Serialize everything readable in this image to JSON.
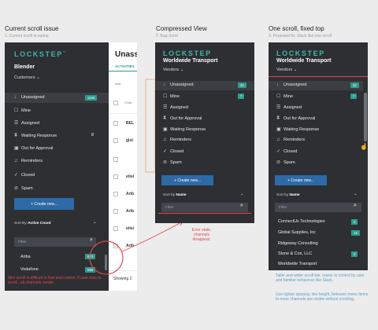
{
  "sections": [
    {
      "title": "Current scroll issue",
      "subtitle": "1. Current scroll in laptop"
    },
    {
      "title": "Compressed View",
      "subtitle": "2. Bug: Error"
    },
    {
      "title": "One scroll, fixed top",
      "subtitle": "3. Proposed fix: Slack like one scroll"
    }
  ],
  "panel1": {
    "logo": "LOCKSTEP",
    "logo_tm": "™",
    "org": "Blender",
    "dropdown": "Customers",
    "menu": [
      {
        "icon": "unassigned-icon",
        "glyph": "↓",
        "label": "Unassigned",
        "count": "1146"
      },
      {
        "icon": "mine-icon",
        "glyph": "☐",
        "label": "Mine",
        "count": ""
      },
      {
        "icon": "assigned-icon",
        "glyph": "☰",
        "label": "Assigned",
        "count": ""
      },
      {
        "icon": "waiting-response-icon",
        "glyph": "⧗",
        "label": "Waiting Response",
        "count": "8"
      },
      {
        "icon": "out-for-approval-icon",
        "glyph": "▣",
        "label": "Out for Approval",
        "count": ""
      },
      {
        "icon": "reminders-icon",
        "glyph": "♫",
        "label": "Reminders",
        "count": ""
      },
      {
        "icon": "closed-icon",
        "glyph": "✓",
        "label": "Closed",
        "count": ""
      },
      {
        "icon": "spam-icon",
        "glyph": "⊘",
        "label": "Spam",
        "count": ""
      }
    ],
    "create_label": "+ Create new...",
    "sort_prefix": "Sort By ",
    "sort_value": "Active Count",
    "filter_placeholder": "Filter",
    "vendors": [
      {
        "name": "Ariba",
        "count": "573"
      },
      {
        "name": "Vodafone",
        "count": "555"
      }
    ],
    "note": "Mini scroll is difficult to find and control. If user tries to scroll , all channels vanish."
  },
  "content": {
    "title": "Unass",
    "tab": "ACTIVITIES",
    "col_label": "Assi",
    "col2": "CHAI",
    "rows": [
      "BEL",
      "glol",
      "",
      "etisi",
      "Arib",
      "Arib",
      "etisi",
      "Arib"
    ],
    "footer": "Showing 2"
  },
  "panel2": {
    "logo": "LOCKSTEP",
    "org": "Worldwide Transport",
    "dropdown": "Vendors",
    "menu": [
      {
        "icon": "unassigned-icon",
        "glyph": "↓",
        "label": "Unassigned",
        "count": "32"
      },
      {
        "icon": "mine-icon",
        "glyph": "☐",
        "label": "Mine",
        "count": "7"
      },
      {
        "icon": "assigned-icon",
        "glyph": "☰",
        "label": "Assigned",
        "count": ""
      },
      {
        "icon": "out-for-approval-icon",
        "glyph": "⧗",
        "label": "Out for Approval",
        "count": ""
      },
      {
        "icon": "waiting-response-icon",
        "glyph": "▣",
        "label": "Waiting Response",
        "count": ""
      },
      {
        "icon": "reminders-icon",
        "glyph": "♫",
        "label": "Reminders",
        "count": ""
      },
      {
        "icon": "closed-icon",
        "glyph": "✓",
        "label": "Closed",
        "count": ""
      },
      {
        "icon": "spam-icon",
        "glyph": "⊘",
        "label": "Spam",
        "count": ""
      }
    ],
    "create_label": "+ Create new...",
    "sort_prefix": "Sort by ",
    "sort_value": "Name",
    "filter_placeholder": "Filter",
    "error_note": "Error state, channels disappear."
  },
  "panel3": {
    "logo": "LOCKSTEP",
    "org": "Worldwide Transport",
    "dropdown": "Vendors",
    "menu": [
      {
        "icon": "unassigned-icon",
        "glyph": "↓",
        "label": "Unassigned",
        "count": "32"
      },
      {
        "icon": "mine-icon",
        "glyph": "☐",
        "label": "Mine",
        "count": "7"
      },
      {
        "icon": "assigned-icon",
        "glyph": "☰",
        "label": "Assigned",
        "count": ""
      },
      {
        "icon": "out-for-approval-icon",
        "glyph": "⧗",
        "label": "Out for Approval",
        "count": ""
      },
      {
        "icon": "waiting-response-icon",
        "glyph": "▣",
        "label": "Waiting Response",
        "count": ""
      },
      {
        "icon": "reminders-icon",
        "glyph": "♫",
        "label": "Reminders",
        "count": ""
      },
      {
        "icon": "closed-icon",
        "glyph": "✓",
        "label": "Closed",
        "count": ""
      },
      {
        "icon": "spam-icon",
        "glyph": "⊘",
        "label": "Spam",
        "count": ""
      }
    ],
    "create_label": "+ Create new...",
    "sort_prefix": "Sort by ",
    "sort_value": "Name",
    "filter_placeholder": "Filter",
    "vendors": [
      {
        "name": "ConnectUs Technologies",
        "count": "2"
      },
      {
        "name": "Global Supplies, Inc",
        "count": "15"
      },
      {
        "name": "Ridgeway Consulting",
        "count": ""
      },
      {
        "name": "Stone & Cox, LLC",
        "count": "2"
      },
      {
        "name": "Worldwide Transport",
        "count": ""
      }
    ],
    "note1": "Taller and wider scroll bar, easier to control by user and familiar behaviour like Slack.",
    "note2": "Use tighter spacing, line height, between menu items to more channels are visible without scrolling."
  },
  "colors": {
    "accent": "#3fb7a6",
    "badge": "#2a9d8f",
    "button": "#2d6aa6",
    "error": "#e44a4a",
    "sidebar": "#2d2f33"
  }
}
